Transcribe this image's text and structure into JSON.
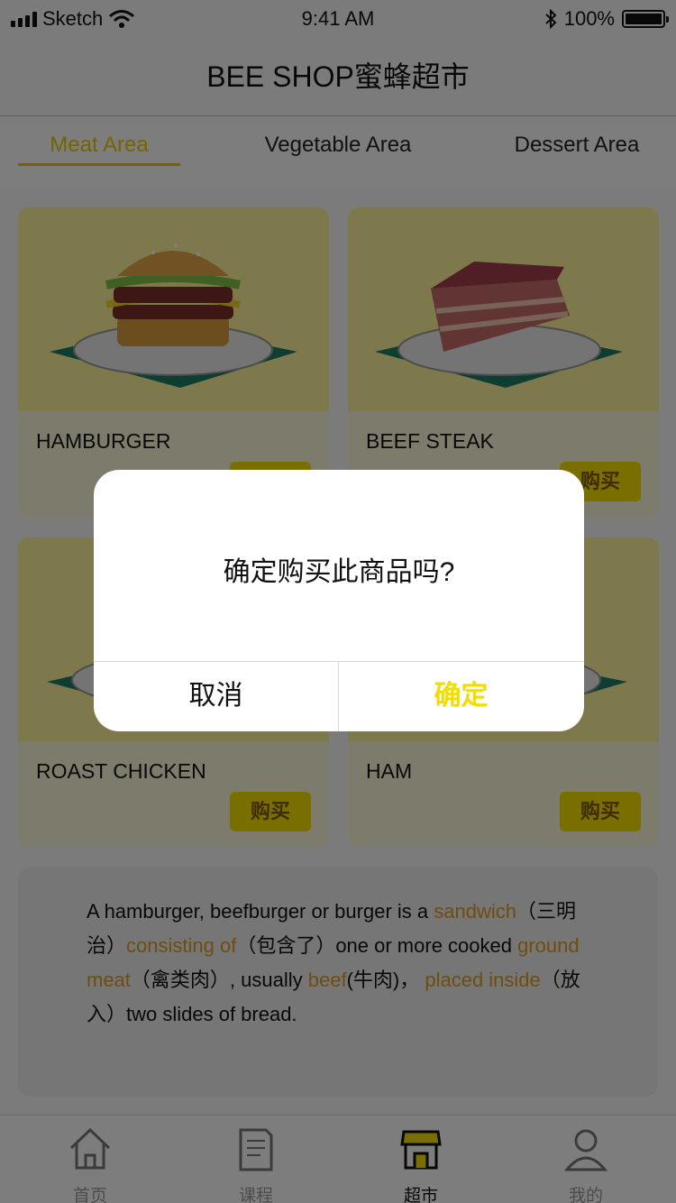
{
  "status_bar": {
    "carrier": "Sketch",
    "time": "9:41 AM",
    "battery": "100%"
  },
  "nav": {
    "title": "BEE SHOP蜜蜂超市"
  },
  "tabs": [
    {
      "label": "Meat Area",
      "active": true
    },
    {
      "label": "Vegetable Area",
      "active": false
    },
    {
      "label": "Dessert Area",
      "active": false
    }
  ],
  "products": [
    {
      "name": "HAMBURGER",
      "buy_label": "购买",
      "icon": "hamburger-image"
    },
    {
      "name": "BEEF STEAK",
      "buy_label": "购买",
      "icon": "beef-steak-image"
    },
    {
      "name": "ROAST CHICKEN",
      "buy_label": "购买",
      "icon": "roast-chicken-image"
    },
    {
      "name": "HAM",
      "buy_label": "购买",
      "icon": "ham-image"
    }
  ],
  "info": {
    "t1": "A hamburger, beefburger or burger is a ",
    "h1": "sandwich",
    "t2": "（三明治）",
    "h2": "consisting of",
    "t3": "（包含了）one or more cooked ",
    "h3": "ground meat",
    "t4": "（禽类肉）, usually ",
    "h4": "beef",
    "t5": "(牛肉)， ",
    "h5": "placed inside",
    "t6": "（放入）two slides of bread."
  },
  "tabbar": [
    {
      "label": "首页",
      "icon": "home-icon",
      "active": false
    },
    {
      "label": "课程",
      "icon": "document-icon",
      "active": false
    },
    {
      "label": "超市",
      "icon": "shop-icon",
      "active": true
    },
    {
      "label": "我的",
      "icon": "profile-icon",
      "active": false
    }
  ],
  "dialog": {
    "message": "确定购买此商品吗?",
    "cancel_label": "取消",
    "confirm_label": "确定"
  },
  "colors": {
    "accent": "#f3dc00",
    "highlight": "#e09a1c"
  }
}
